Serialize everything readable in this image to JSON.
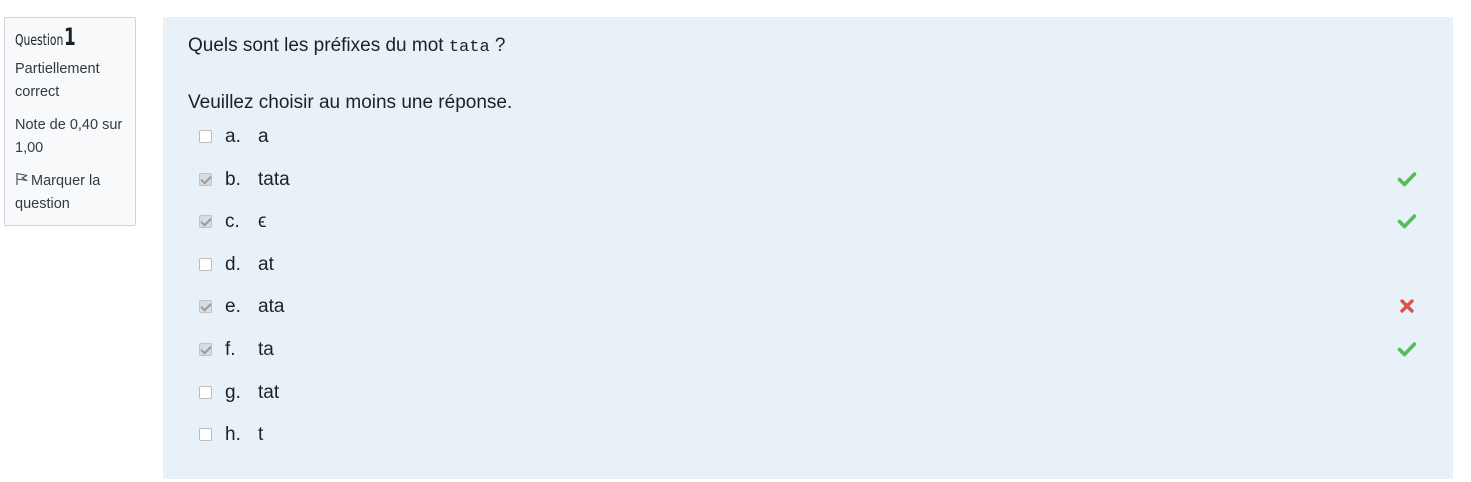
{
  "info": {
    "question_word": "Question",
    "question_number": "1",
    "state": "Partiellement correct",
    "grade": "Note de 0,40 sur 1,00",
    "flag_label": "Marquer la question",
    "flag_icon": "flag-icon"
  },
  "question": {
    "text_before": "Quels sont les préfixes du mot ",
    "code_word": "tata",
    "text_after": " ?",
    "prompt": "Veuillez choisir au moins une réponse."
  },
  "answers": [
    {
      "letter": "a.",
      "text": "a",
      "checked": false,
      "feedback": "none"
    },
    {
      "letter": "b.",
      "text": "tata",
      "checked": true,
      "feedback": "correct"
    },
    {
      "letter": "c.",
      "text": "ϵ",
      "checked": true,
      "feedback": "correct"
    },
    {
      "letter": "d.",
      "text": "at",
      "checked": false,
      "feedback": "none"
    },
    {
      "letter": "e.",
      "text": "ata",
      "checked": true,
      "feedback": "incorrect"
    },
    {
      "letter": "f.",
      "text": "ta",
      "checked": true,
      "feedback": "correct"
    },
    {
      "letter": "g.",
      "text": "tat",
      "checked": false,
      "feedback": "none"
    },
    {
      "letter": "h.",
      "text": "t",
      "checked": false,
      "feedback": "none"
    }
  ],
  "colors": {
    "correct": "#5cb85c",
    "incorrect": "#d9534f",
    "content_bg": "#e7f1f7",
    "info_bg": "#f8f9fa"
  }
}
